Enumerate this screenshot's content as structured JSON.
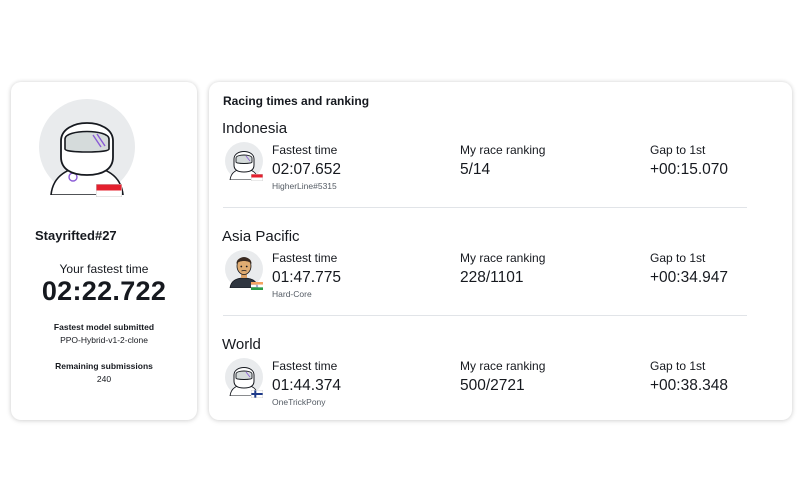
{
  "profile": {
    "username": "Stayrifted#27",
    "fastest_label": "Your fastest time",
    "fastest_time": "02:22.722",
    "model_label": "Fastest model submitted",
    "model_name": "PPO-Hybrid-v1-2-clone",
    "remaining_label": "Remaining submissions",
    "remaining_value": "240",
    "avatar_icon": "helmet-avatar-icon",
    "flag_icon": "indonesia-flag-icon"
  },
  "ranking": {
    "title": "Racing times and ranking",
    "col_fastest": "Fastest time",
    "col_rank": "My race ranking",
    "col_gap": "Gap to 1st",
    "regions": [
      {
        "name": "Indonesia",
        "fastest_time": "02:07.652",
        "racer": "HigherLine#5315",
        "rank": "5/14",
        "gap": "+00:15.070",
        "avatar_icon": "helmet-avatar-icon",
        "flag_icon": "indonesia-flag-icon"
      },
      {
        "name": "Asia Pacific",
        "fastest_time": "01:47.775",
        "racer": "Hard-Core",
        "rank": "228/1101",
        "gap": "+00:34.947",
        "avatar_icon": "person-avatar-icon",
        "flag_icon": "india-flag-icon"
      },
      {
        "name": "World",
        "fastest_time": "01:44.374",
        "racer": "OneTrickPony",
        "rank": "500/2721",
        "gap": "+00:38.348",
        "avatar_icon": "helmet-avatar-icon",
        "flag_icon": "finland-flag-icon"
      }
    ]
  },
  "colors": {
    "accent_purple": "#8a5bd6",
    "flag_red": "#e4202e",
    "text": "#16191f",
    "muted": "#545b64"
  }
}
